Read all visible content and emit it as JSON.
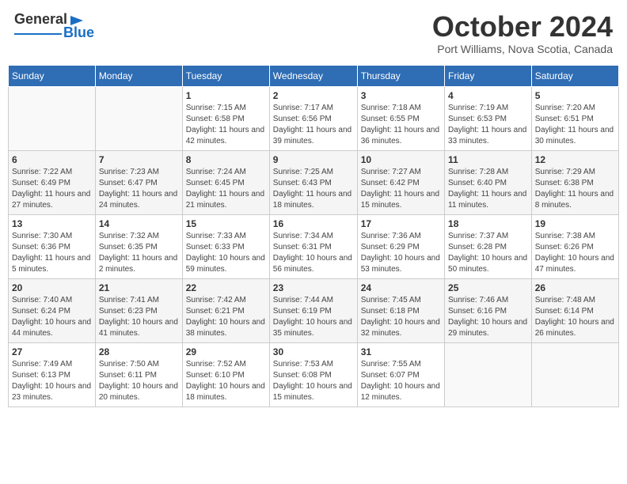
{
  "header": {
    "logo": {
      "line1": "General",
      "line2": "Blue"
    },
    "title": "October 2024",
    "location": "Port Williams, Nova Scotia, Canada"
  },
  "days_of_week": [
    "Sunday",
    "Monday",
    "Tuesday",
    "Wednesday",
    "Thursday",
    "Friday",
    "Saturday"
  ],
  "weeks": [
    [
      {
        "day": "",
        "sunrise": "",
        "sunset": "",
        "daylight": ""
      },
      {
        "day": "",
        "sunrise": "",
        "sunset": "",
        "daylight": ""
      },
      {
        "day": "1",
        "sunrise": "Sunrise: 7:15 AM",
        "sunset": "Sunset: 6:58 PM",
        "daylight": "Daylight: 11 hours and 42 minutes."
      },
      {
        "day": "2",
        "sunrise": "Sunrise: 7:17 AM",
        "sunset": "Sunset: 6:56 PM",
        "daylight": "Daylight: 11 hours and 39 minutes."
      },
      {
        "day": "3",
        "sunrise": "Sunrise: 7:18 AM",
        "sunset": "Sunset: 6:55 PM",
        "daylight": "Daylight: 11 hours and 36 minutes."
      },
      {
        "day": "4",
        "sunrise": "Sunrise: 7:19 AM",
        "sunset": "Sunset: 6:53 PM",
        "daylight": "Daylight: 11 hours and 33 minutes."
      },
      {
        "day": "5",
        "sunrise": "Sunrise: 7:20 AM",
        "sunset": "Sunset: 6:51 PM",
        "daylight": "Daylight: 11 hours and 30 minutes."
      }
    ],
    [
      {
        "day": "6",
        "sunrise": "Sunrise: 7:22 AM",
        "sunset": "Sunset: 6:49 PM",
        "daylight": "Daylight: 11 hours and 27 minutes."
      },
      {
        "day": "7",
        "sunrise": "Sunrise: 7:23 AM",
        "sunset": "Sunset: 6:47 PM",
        "daylight": "Daylight: 11 hours and 24 minutes."
      },
      {
        "day": "8",
        "sunrise": "Sunrise: 7:24 AM",
        "sunset": "Sunset: 6:45 PM",
        "daylight": "Daylight: 11 hours and 21 minutes."
      },
      {
        "day": "9",
        "sunrise": "Sunrise: 7:25 AM",
        "sunset": "Sunset: 6:43 PM",
        "daylight": "Daylight: 11 hours and 18 minutes."
      },
      {
        "day": "10",
        "sunrise": "Sunrise: 7:27 AM",
        "sunset": "Sunset: 6:42 PM",
        "daylight": "Daylight: 11 hours and 15 minutes."
      },
      {
        "day": "11",
        "sunrise": "Sunrise: 7:28 AM",
        "sunset": "Sunset: 6:40 PM",
        "daylight": "Daylight: 11 hours and 11 minutes."
      },
      {
        "day": "12",
        "sunrise": "Sunrise: 7:29 AM",
        "sunset": "Sunset: 6:38 PM",
        "daylight": "Daylight: 11 hours and 8 minutes."
      }
    ],
    [
      {
        "day": "13",
        "sunrise": "Sunrise: 7:30 AM",
        "sunset": "Sunset: 6:36 PM",
        "daylight": "Daylight: 11 hours and 5 minutes."
      },
      {
        "day": "14",
        "sunrise": "Sunrise: 7:32 AM",
        "sunset": "Sunset: 6:35 PM",
        "daylight": "Daylight: 11 hours and 2 minutes."
      },
      {
        "day": "15",
        "sunrise": "Sunrise: 7:33 AM",
        "sunset": "Sunset: 6:33 PM",
        "daylight": "Daylight: 10 hours and 59 minutes."
      },
      {
        "day": "16",
        "sunrise": "Sunrise: 7:34 AM",
        "sunset": "Sunset: 6:31 PM",
        "daylight": "Daylight: 10 hours and 56 minutes."
      },
      {
        "day": "17",
        "sunrise": "Sunrise: 7:36 AM",
        "sunset": "Sunset: 6:29 PM",
        "daylight": "Daylight: 10 hours and 53 minutes."
      },
      {
        "day": "18",
        "sunrise": "Sunrise: 7:37 AM",
        "sunset": "Sunset: 6:28 PM",
        "daylight": "Daylight: 10 hours and 50 minutes."
      },
      {
        "day": "19",
        "sunrise": "Sunrise: 7:38 AM",
        "sunset": "Sunset: 6:26 PM",
        "daylight": "Daylight: 10 hours and 47 minutes."
      }
    ],
    [
      {
        "day": "20",
        "sunrise": "Sunrise: 7:40 AM",
        "sunset": "Sunset: 6:24 PM",
        "daylight": "Daylight: 10 hours and 44 minutes."
      },
      {
        "day": "21",
        "sunrise": "Sunrise: 7:41 AM",
        "sunset": "Sunset: 6:23 PM",
        "daylight": "Daylight: 10 hours and 41 minutes."
      },
      {
        "day": "22",
        "sunrise": "Sunrise: 7:42 AM",
        "sunset": "Sunset: 6:21 PM",
        "daylight": "Daylight: 10 hours and 38 minutes."
      },
      {
        "day": "23",
        "sunrise": "Sunrise: 7:44 AM",
        "sunset": "Sunset: 6:19 PM",
        "daylight": "Daylight: 10 hours and 35 minutes."
      },
      {
        "day": "24",
        "sunrise": "Sunrise: 7:45 AM",
        "sunset": "Sunset: 6:18 PM",
        "daylight": "Daylight: 10 hours and 32 minutes."
      },
      {
        "day": "25",
        "sunrise": "Sunrise: 7:46 AM",
        "sunset": "Sunset: 6:16 PM",
        "daylight": "Daylight: 10 hours and 29 minutes."
      },
      {
        "day": "26",
        "sunrise": "Sunrise: 7:48 AM",
        "sunset": "Sunset: 6:14 PM",
        "daylight": "Daylight: 10 hours and 26 minutes."
      }
    ],
    [
      {
        "day": "27",
        "sunrise": "Sunrise: 7:49 AM",
        "sunset": "Sunset: 6:13 PM",
        "daylight": "Daylight: 10 hours and 23 minutes."
      },
      {
        "day": "28",
        "sunrise": "Sunrise: 7:50 AM",
        "sunset": "Sunset: 6:11 PM",
        "daylight": "Daylight: 10 hours and 20 minutes."
      },
      {
        "day": "29",
        "sunrise": "Sunrise: 7:52 AM",
        "sunset": "Sunset: 6:10 PM",
        "daylight": "Daylight: 10 hours and 18 minutes."
      },
      {
        "day": "30",
        "sunrise": "Sunrise: 7:53 AM",
        "sunset": "Sunset: 6:08 PM",
        "daylight": "Daylight: 10 hours and 15 minutes."
      },
      {
        "day": "31",
        "sunrise": "Sunrise: 7:55 AM",
        "sunset": "Sunset: 6:07 PM",
        "daylight": "Daylight: 10 hours and 12 minutes."
      },
      {
        "day": "",
        "sunrise": "",
        "sunset": "",
        "daylight": ""
      },
      {
        "day": "",
        "sunrise": "",
        "sunset": "",
        "daylight": ""
      }
    ]
  ]
}
